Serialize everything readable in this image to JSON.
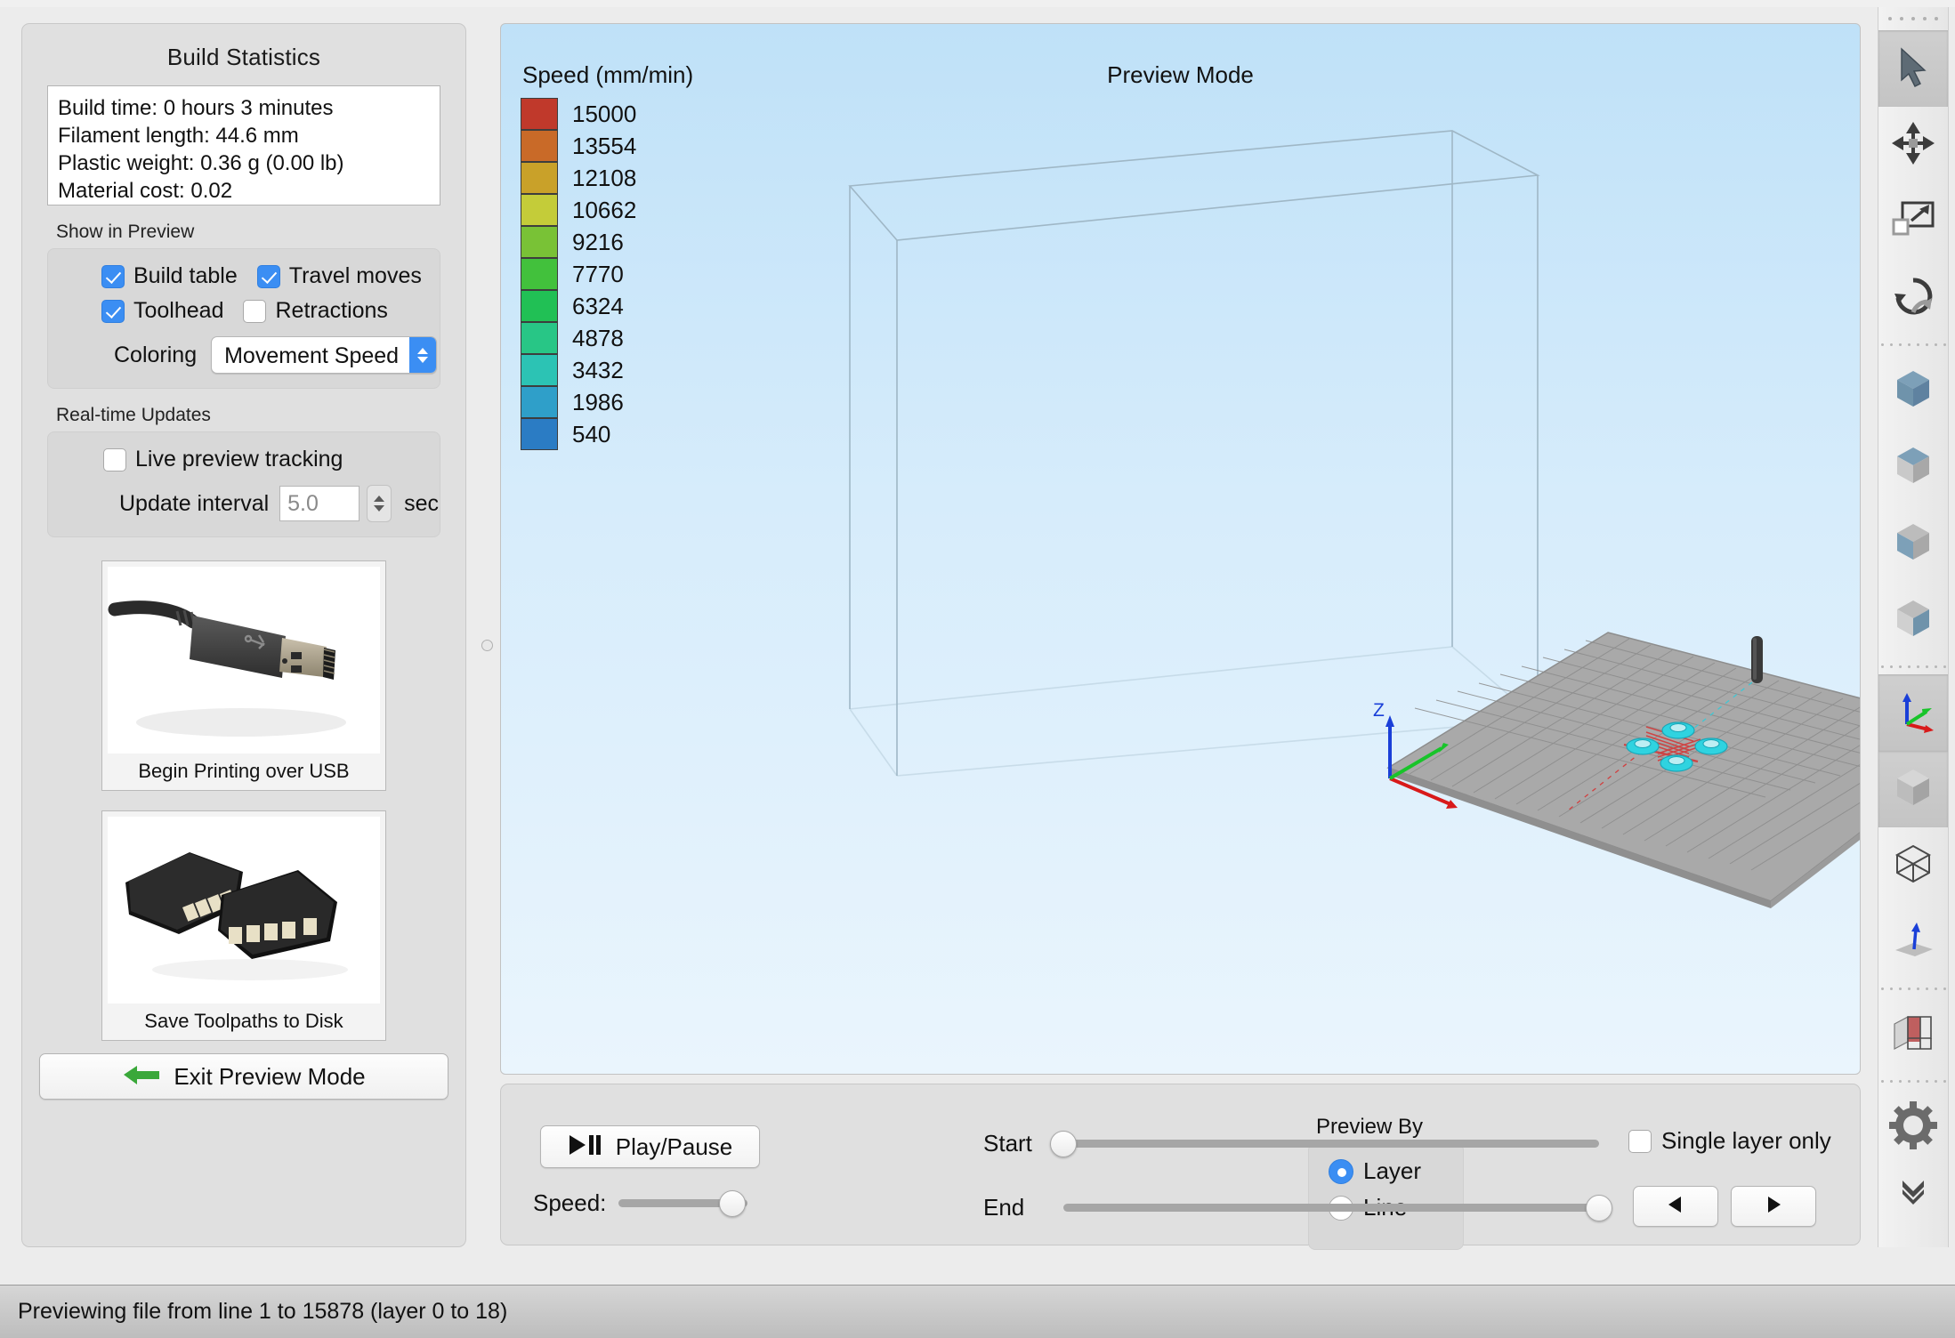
{
  "left_panel": {
    "title": "Build Statistics",
    "stats": [
      "Build time: 0 hours 3 minutes",
      "Filament length: 44.6 mm",
      "Plastic weight: 0.36 g (0.00 lb)",
      "Material cost: 0.02"
    ],
    "show_in_preview": {
      "label": "Show in Preview",
      "checkboxes": [
        {
          "label": "Build table",
          "checked": true
        },
        {
          "label": "Travel moves",
          "checked": true
        },
        {
          "label": "Toolhead",
          "checked": true
        },
        {
          "label": "Retractions",
          "checked": false
        }
      ],
      "coloring_label": "Coloring",
      "coloring_value": "Movement Speed"
    },
    "realtime": {
      "label": "Real-time Updates",
      "live_tracking_label": "Live preview tracking",
      "live_tracking_checked": false,
      "update_interval_label": "Update interval",
      "update_interval_value": "5.0",
      "unit_label": "sec"
    },
    "usb_button_label": "Begin Printing over USB",
    "sd_button_label": "Save Toolpaths to Disk",
    "exit_button_label": "Exit Preview Mode"
  },
  "viewport": {
    "mode_title": "Preview Mode",
    "legend_title": "Speed (mm/min)",
    "legend": [
      {
        "value": "15000",
        "color": "#c0392b"
      },
      {
        "value": "13554",
        "color": "#c96a28"
      },
      {
        "value": "12108",
        "color": "#c9a129"
      },
      {
        "value": "10662",
        "color": "#c4cc39"
      },
      {
        "value": "9216",
        "color": "#79c236"
      },
      {
        "value": "7770",
        "color": "#42c13c"
      },
      {
        "value": "6324",
        "color": "#21c055"
      },
      {
        "value": "4878",
        "color": "#28c686"
      },
      {
        "value": "3432",
        "color": "#2cc3b4"
      },
      {
        "value": "1986",
        "color": "#2f9fc9"
      },
      {
        "value": "540",
        "color": "#2b7cc4"
      }
    ],
    "axis_label_z": "Z"
  },
  "controls": {
    "play_pause_label": "Play/Pause",
    "speed_label": "Speed:",
    "speed_value_pct": 88,
    "preview_by_label": "Preview By",
    "preview_by_options": [
      {
        "label": "Layer",
        "selected": true
      },
      {
        "label": "Line",
        "selected": false
      }
    ],
    "start_label": "Start",
    "start_value_pct": 0,
    "end_label": "End",
    "end_value_pct": 100,
    "single_layer_label": "Single layer only",
    "single_layer_checked": false,
    "prev_button_icon": "triangle-left-icon",
    "next_button_icon": "triangle-right-icon"
  },
  "toolbar": {
    "items": [
      {
        "name": "select-tool",
        "icon": "cursor-arrow-icon",
        "selected": true
      },
      {
        "name": "move-tool",
        "icon": "move-arrows-icon",
        "selected": false
      },
      {
        "name": "scale-tool",
        "icon": "scale-icon",
        "selected": false
      },
      {
        "name": "rotate-tool",
        "icon": "rotate-icon",
        "selected": false
      },
      {
        "name": "view-top",
        "icon": "cube-top-icon",
        "selected": false
      },
      {
        "name": "view-front",
        "icon": "cube-front-icon",
        "selected": false
      },
      {
        "name": "view-left",
        "icon": "cube-left-icon",
        "selected": false
      },
      {
        "name": "view-right",
        "icon": "cube-right-icon",
        "selected": false
      },
      {
        "name": "show-axes",
        "icon": "axes-icon",
        "selected": true
      },
      {
        "name": "solid-view",
        "icon": "solid-cube-icon",
        "selected": true
      },
      {
        "name": "wireframe-view",
        "icon": "wireframe-cube-icon",
        "selected": false
      },
      {
        "name": "normals-view",
        "icon": "normal-arrow-icon",
        "selected": false
      },
      {
        "name": "cross-section",
        "icon": "cross-section-icon",
        "selected": false
      },
      {
        "name": "settings",
        "icon": "gear-icon",
        "selected": false
      },
      {
        "name": "more",
        "icon": "double-chevron-down-icon",
        "selected": false
      }
    ]
  },
  "status_bar": {
    "text": "Previewing file from line 1 to 15878 (layer 0 to 18)"
  }
}
